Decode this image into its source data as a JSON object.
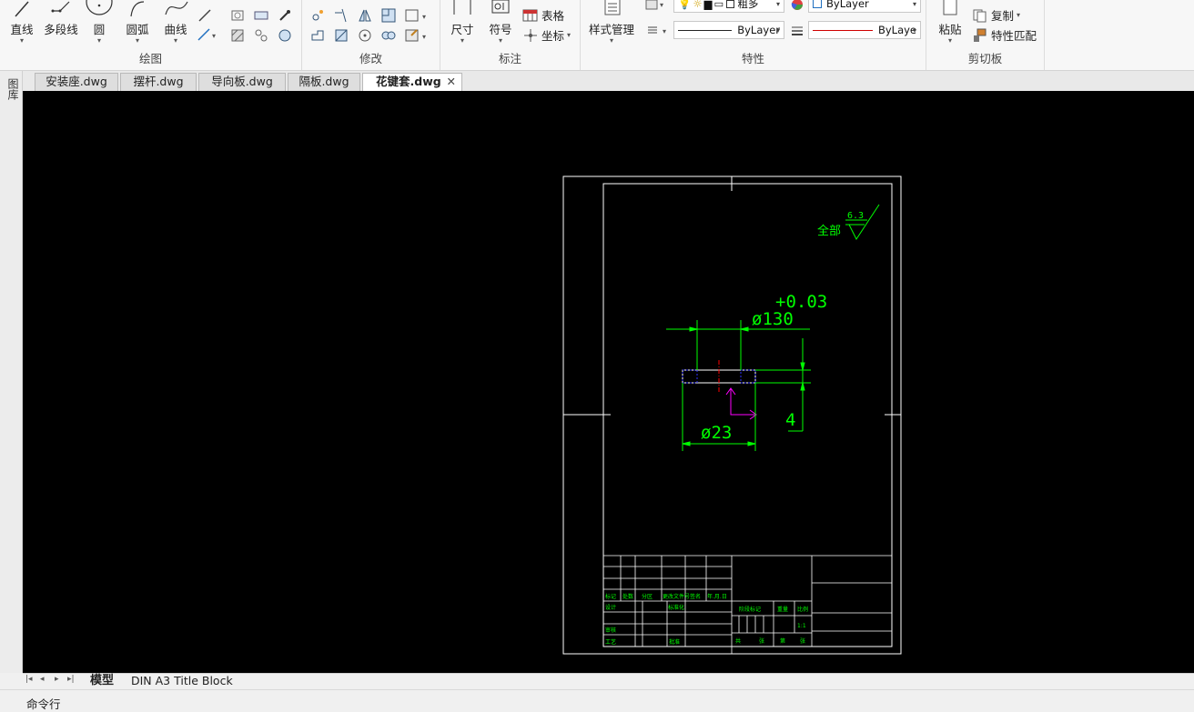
{
  "ribbon": {
    "draw": {
      "label": "绘图",
      "line": "直线",
      "polyline": "多段线",
      "circle": "圆",
      "arc": "圆弧",
      "curve": "曲线"
    },
    "modify": {
      "label": "修改"
    },
    "annotate": {
      "label": "标注",
      "dimension": "尺寸",
      "symbol": "符号",
      "table": "表格",
      "coordinate": "坐标"
    },
    "properties": {
      "label": "特性",
      "style_manager": "样式管理",
      "layer_name": "粗多",
      "color": "ByLayer",
      "linetype": "ByLayer",
      "lineweight": "ByLaye"
    },
    "clipboard": {
      "label": "剪切板",
      "paste": "粘贴",
      "copy": "复制",
      "match_props": "特性匹配"
    }
  },
  "tabs": [
    "安装座.dwg",
    "摆杆.dwg",
    "导向板.dwg",
    "隔板.dwg",
    "花键套.dwg"
  ],
  "active_tab": "花键套.dwg",
  "side_panel_label": "图库",
  "drawing": {
    "surface_finish_label": "全部",
    "surface_finish_value": "6.3",
    "tolerance": "+0.03",
    "dim_outer": "ø130",
    "dim_inner": "ø23",
    "dim_thickness": "4",
    "title_block": {
      "row1": [
        "标记",
        "处数",
        "分区",
        "更改文件号",
        "签名",
        "年.月.日"
      ],
      "design": "设计",
      "standardize": "标准化",
      "stage_mark": "阶段标记",
      "weight": "重量",
      "scale": "比例",
      "scale_value": "1:1",
      "review": "审核",
      "process": "工艺",
      "approve": "批准",
      "sheet": [
        "共",
        "张",
        "第",
        "张"
      ]
    }
  },
  "layout_tabs": [
    "模型",
    "DIN A3 Title Block"
  ],
  "active_layout": "模型",
  "command_line": "命令行",
  "colors": {
    "canvas": "#000000",
    "drawing_white": "#ffffff",
    "dimension_green": "#00ff00",
    "center_red": "#ff0000",
    "ucs_magenta": "#ff00ff",
    "hidden_blue": "#3030ff"
  }
}
